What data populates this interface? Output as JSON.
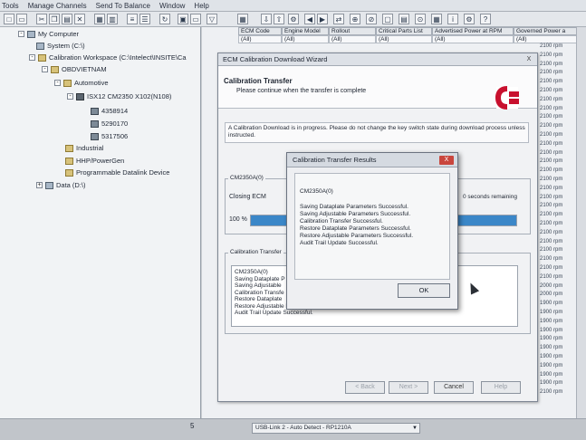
{
  "menu": [
    "Tools",
    "Manage Channels",
    "Send To Balance",
    "Window",
    "Help"
  ],
  "tree": {
    "items": [
      {
        "label": "My Computer",
        "icon": "computer-icon",
        "expander": "-"
      },
      {
        "label": "System (C:\\)",
        "icon": "drive-icon",
        "expander": ""
      },
      {
        "label": "Calibration Workspace (C:\\Intelect\\INSITE\\Ca",
        "icon": "folder-icon",
        "expander": "-"
      },
      {
        "label": "OBDVIETNAM",
        "icon": "folder-icon",
        "expander": "-"
      },
      {
        "label": "Automotive",
        "icon": "folder-icon",
        "expander": "-"
      },
      {
        "label": "ISX12 CM2350 X102(N108)",
        "icon": "ecm-icon",
        "expander": "-"
      },
      {
        "label": "4358914",
        "icon": "calibration-icon",
        "expander": ""
      },
      {
        "label": "5290170",
        "icon": "calibration-icon",
        "expander": ""
      },
      {
        "label": "5317506",
        "icon": "calibration-icon",
        "expander": ""
      },
      {
        "label": "Industrial",
        "icon": "folder-icon",
        "expander": ""
      },
      {
        "label": "HHP/PowerGen",
        "icon": "folder-icon",
        "expander": ""
      },
      {
        "label": "Programmable Datalink Device",
        "icon": "folder-icon",
        "expander": ""
      },
      {
        "label": "Data (D:\\)",
        "icon": "drive-icon",
        "expander": "+"
      }
    ]
  },
  "grid": {
    "headers": [
      "ECM Code",
      "Engine Model",
      "Rollout",
      "Critical Parts List",
      "Advertised Power at RPM",
      "Governed Power a"
    ],
    "filters": [
      "(All)",
      "(All)",
      "(All)",
      "(All)",
      "(All)",
      "(All)"
    ],
    "speeds": [
      "2100 rpm",
      "2100 rpm",
      "2100 rpm",
      "2100 rpm",
      "2100 rpm",
      "2100 rpm",
      "2100 rpm",
      "2100 rpm",
      "2100 rpm",
      "2100 rpm",
      "2100 rpm",
      "2100 rpm",
      "2100 rpm",
      "2100 rpm",
      "2100 rpm",
      "2100 rpm",
      "2100 rpm",
      "2100 rpm",
      "2100 rpm",
      "2100 rpm",
      "2100 rpm",
      "2100 rpm",
      "2100 rpm",
      "2100 rpm",
      "2100 rpm",
      "2100 rpm",
      "2100 rpm",
      "2000 rpm",
      "2000 rpm",
      "1900 rpm",
      "1900 rpm",
      "1900 rpm",
      "1900 rpm",
      "1900 rpm",
      "1900 rpm",
      "1900 rpm",
      "1900 rpm",
      "1900 rpm",
      "1900 rpm",
      "2100 rpm"
    ]
  },
  "wizard": {
    "title": "ECM Calibration Download Wizard",
    "close": "X",
    "heading": "Calibration Transfer",
    "subheading": "Please continue when the transfer is complete",
    "message": "A Calibration Download is in progress.  Please do not change the key switch state during download process unless instructed.",
    "device_group": "CM2350A(0)",
    "status": "Closing ECM",
    "remaining": "0 seconds remaining",
    "progress_label": "100 %",
    "progress": 100,
    "results_group": "Calibration Transfer",
    "results_lines": [
      "CM2350A(0)",
      "Saving Dataplate P",
      "Saving Adjustable",
      "Calibration Transfe",
      "Restore Dataplate",
      "Restore Adjustable Parameters Successful.",
      "Audit Trail Update Successful."
    ],
    "buttons": [
      "< Back",
      "Next >",
      "Cancel",
      "Help"
    ]
  },
  "dialog": {
    "title": "Calibration Transfer Results",
    "close": "X",
    "device": "CM2350A(0)",
    "lines": [
      "Saving Dataplate Parameters Successful.",
      "Saving Adjustable Parameters Successful.",
      "Calibration Transfer Successful.",
      "Restore Dataplate Parameters Successful.",
      "Restore Adjustable Parameters Successful.",
      "Audit Trail Update Successful."
    ],
    "ok": "OK"
  },
  "statusbar": {
    "connection": "USB-Link 2 - Auto Detect - RP1210A",
    "number": "5"
  },
  "colors": {
    "progress": "#3b87c8",
    "close": "#c9463d",
    "logo": "#c8102e"
  }
}
